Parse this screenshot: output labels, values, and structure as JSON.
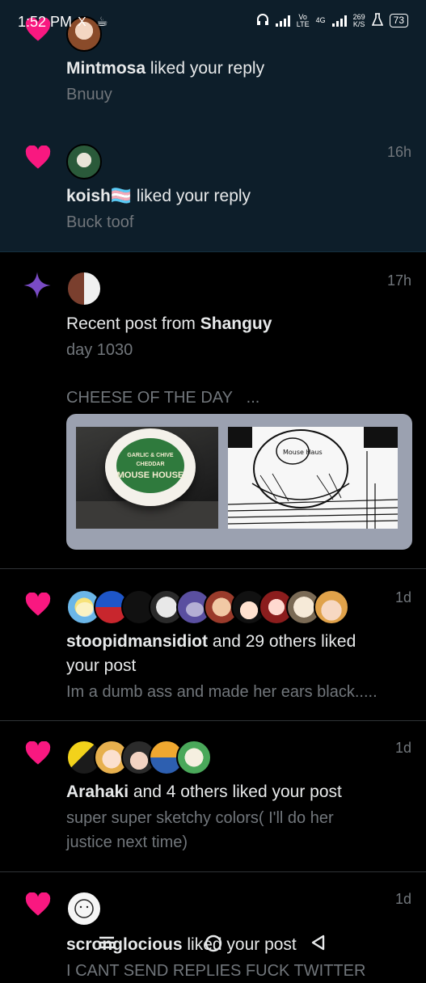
{
  "status_bar": {
    "time": "1:52 PM",
    "left_icons": "X ☕",
    "volte": "Vo\nLTE",
    "network": "4G",
    "speed_value": "269",
    "speed_unit": "K/S",
    "battery": "73"
  },
  "notifications": [
    {
      "type": "like",
      "icon": "heart-icon",
      "actor": "Mintmosa",
      "action": " liked your reply",
      "snippet": "Bnuuy",
      "time": "",
      "unread": true
    },
    {
      "type": "like",
      "icon": "heart-icon",
      "actor": "koish🏳️‍⚧️",
      "action": " liked your reply",
      "snippet": "Buck toof",
      "time": "16h",
      "unread": true
    },
    {
      "type": "recent_post",
      "icon": "sparkle-icon",
      "prefix": "Recent post from ",
      "actor": "Shanguy",
      "snippet": "day 1030",
      "snippet2": "CHEESE OF THE DAY",
      "more": "...",
      "time": "17h",
      "media": {
        "label_line1": "GARLIC & CHIVE CHEDDAR",
        "label_line2": "MOUSE HOUSE",
        "sketch_label": "Mouse Haus"
      }
    },
    {
      "type": "like",
      "icon": "heart-icon",
      "actor": "stoopidmansidiot",
      "action": " and 29 others liked",
      "action2": "your post",
      "snippet": "Im a dumb ass and made her ears black.....",
      "time": "1d"
    },
    {
      "type": "like",
      "icon": "heart-icon",
      "actor": "Arahaki",
      "action": " and 4 others liked your post",
      "snippet": "super super sketchy colors( I'll do her",
      "snippet2": "justice next time)",
      "time": "1d"
    },
    {
      "type": "like",
      "icon": "heart-icon",
      "actor": "scronglocious",
      "action": " liked your post",
      "snippet": "I CANT SEND REPLIES FUCK TWITTER",
      "time": "1d"
    }
  ],
  "colors": {
    "heart": "#f91880",
    "sparkle": "#794bc4",
    "unread_bg": "#0d1e2a",
    "muted": "#71767b"
  },
  "nav": {
    "menu_icon": "menu-icon",
    "home_icon": "home-circle-icon",
    "back_icon": "back-triangle-icon"
  }
}
